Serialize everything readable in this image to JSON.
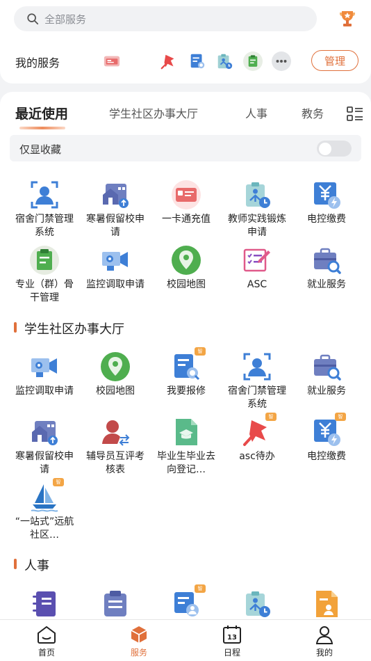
{
  "search": {
    "placeholder": "全部服务"
  },
  "header": {
    "my_services": "我的服务",
    "manage": "管理"
  },
  "tabs": [
    {
      "label": "最近使用"
    },
    {
      "label": "学生社区办事大厅"
    },
    {
      "label": "人事"
    },
    {
      "label": "教务"
    }
  ],
  "favorites": {
    "label": "仅显收藏",
    "enabled": false
  },
  "recent": [
    {
      "label": "宿舍门禁管理系统",
      "icon": "person-scan-icon"
    },
    {
      "label": "寒暑假留校申请",
      "icon": "building-up-icon"
    },
    {
      "label": "一卡通充值",
      "icon": "card-icon"
    },
    {
      "label": "教师实践锻炼申请",
      "icon": "clipboard-clock-icon"
    },
    {
      "label": "电控缴费",
      "icon": "yuan-lightning-icon"
    },
    {
      "label": "专业（群）骨干管理",
      "icon": "clipboard-green-icon"
    },
    {
      "label": "监控调取申请",
      "icon": "camera-icon"
    },
    {
      "label": "校园地图",
      "icon": "map-pin-icon"
    },
    {
      "label": "ASC",
      "icon": "checklist-pen-icon"
    },
    {
      "label": "就业服务",
      "icon": "briefcase-search-icon"
    }
  ],
  "section1": {
    "title": "学生社区办事大厅",
    "badge": "智",
    "items": [
      {
        "label": "监控调取申请",
        "icon": "camera-icon"
      },
      {
        "label": "校园地图",
        "icon": "map-pin-icon"
      },
      {
        "label": "我要报修",
        "icon": "doc-search-icon",
        "badge": true
      },
      {
        "label": "宿舍门禁管理系统",
        "icon": "person-scan-icon"
      },
      {
        "label": "就业服务",
        "icon": "briefcase-search-icon"
      },
      {
        "label": "寒暑假留校申请",
        "icon": "building-up-icon"
      },
      {
        "label": "辅导员互评考核表",
        "icon": "person-swap-icon"
      },
      {
        "label": "毕业生毕业去向登记…",
        "icon": "graduation-doc-icon"
      },
      {
        "label": "asc待办",
        "icon": "pin-icon",
        "badge": true
      },
      {
        "label": "电控缴费",
        "icon": "yuan-lightning-icon",
        "badge": true
      },
      {
        "label": "“一站式”远航社区…",
        "icon": "sailboat-icon",
        "badge": true
      }
    ]
  },
  "section2": {
    "title": "人事"
  },
  "bottom_nav": [
    {
      "label": "首页"
    },
    {
      "label": "服务"
    },
    {
      "label": "日程"
    },
    {
      "label": "我的"
    }
  ],
  "calendar_day": "13",
  "colors": {
    "accent": "#e0703b",
    "blue": "#3e7fd6",
    "green": "#4fae4f"
  }
}
